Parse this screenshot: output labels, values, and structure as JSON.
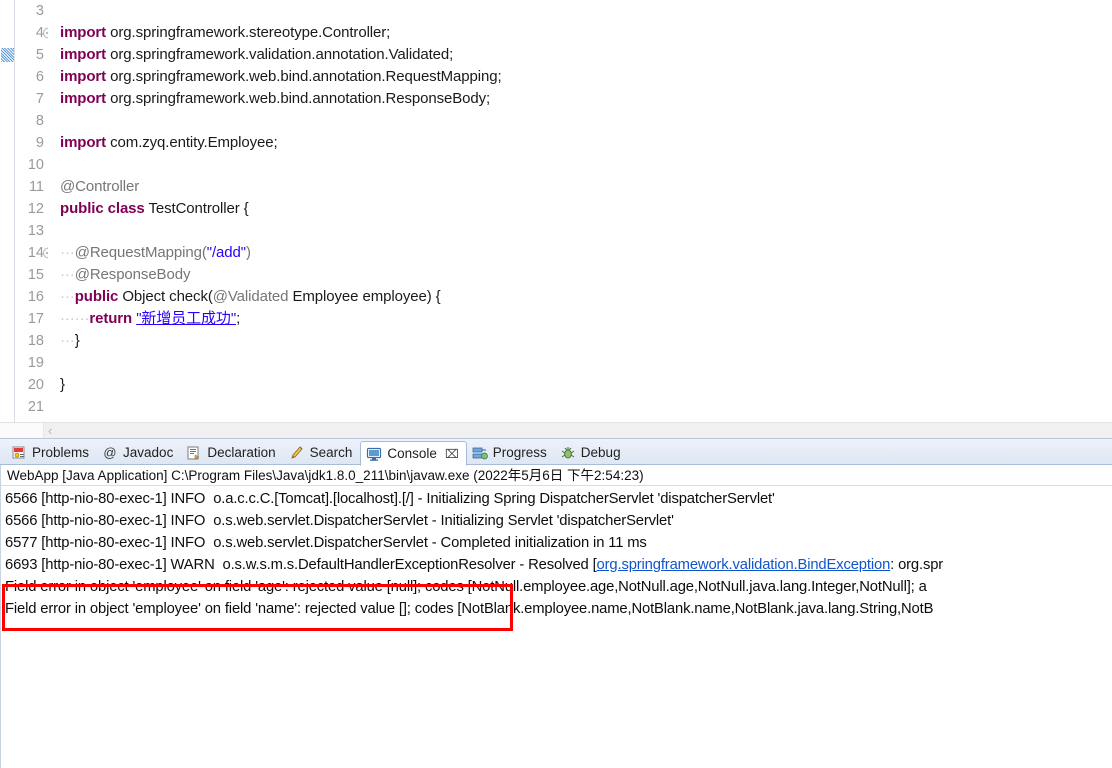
{
  "editor": {
    "lines": [
      {
        "num": "3",
        "fold": false,
        "segments": []
      },
      {
        "num": "4",
        "fold": true,
        "segments": [
          {
            "t": "import",
            "c": "kw"
          },
          {
            "t": " ",
            "c": "ws"
          },
          {
            "t": "org.springframework.stereotype.Controller;",
            "c": "plain"
          }
        ]
      },
      {
        "num": "5",
        "fold": false,
        "marker": true,
        "segments": [
          {
            "t": "import",
            "c": "kw"
          },
          {
            "t": " ",
            "c": "ws"
          },
          {
            "t": "org.springframework.validation.annotation.Validated;",
            "c": "plain"
          }
        ]
      },
      {
        "num": "6",
        "fold": false,
        "segments": [
          {
            "t": "import",
            "c": "kw"
          },
          {
            "t": " ",
            "c": "ws"
          },
          {
            "t": "org.springframework.web.bind.annotation.RequestMapping;",
            "c": "plain"
          }
        ]
      },
      {
        "num": "7",
        "fold": false,
        "segments": [
          {
            "t": "import",
            "c": "kw"
          },
          {
            "t": " ",
            "c": "ws"
          },
          {
            "t": "org.springframework.web.bind.annotation.ResponseBody;",
            "c": "plain"
          }
        ]
      },
      {
        "num": "8",
        "fold": false,
        "segments": []
      },
      {
        "num": "9",
        "fold": false,
        "segments": [
          {
            "t": "import",
            "c": "kw"
          },
          {
            "t": " ",
            "c": "ws"
          },
          {
            "t": "com.zyq.entity.Employee;",
            "c": "plain"
          }
        ]
      },
      {
        "num": "10",
        "fold": false,
        "segments": []
      },
      {
        "num": "11",
        "fold": false,
        "segments": [
          {
            "t": "@Controller",
            "c": "ann"
          }
        ]
      },
      {
        "num": "12",
        "fold": false,
        "segments": [
          {
            "t": "public class",
            "c": "kw"
          },
          {
            "t": " ",
            "c": "ws"
          },
          {
            "t": "TestController {",
            "c": "plain"
          }
        ]
      },
      {
        "num": "13",
        "fold": false,
        "segments": []
      },
      {
        "num": "14",
        "fold": true,
        "segments": [
          {
            "t": "···",
            "c": "ws"
          },
          {
            "t": "@RequestMapping(",
            "c": "ann"
          },
          {
            "t": "\"/add\"",
            "c": "str"
          },
          {
            "t": ")",
            "c": "ann"
          }
        ]
      },
      {
        "num": "15",
        "fold": false,
        "segments": [
          {
            "t": "···",
            "c": "ws"
          },
          {
            "t": "@ResponseBody",
            "c": "ann"
          }
        ]
      },
      {
        "num": "16",
        "fold": false,
        "segments": [
          {
            "t": "···",
            "c": "ws"
          },
          {
            "t": "public",
            "c": "kw"
          },
          {
            "t": " ",
            "c": "ws"
          },
          {
            "t": "Object check(",
            "c": "plain"
          },
          {
            "t": "@Validated",
            "c": "ann"
          },
          {
            "t": " ",
            "c": "ws"
          },
          {
            "t": "Employee employee) {",
            "c": "plain"
          }
        ]
      },
      {
        "num": "17",
        "fold": false,
        "segments": [
          {
            "t": "······",
            "c": "ws"
          },
          {
            "t": "return",
            "c": "kw"
          },
          {
            "t": " ",
            "c": "ws"
          },
          {
            "t": "\"新增员工成功\"",
            "c": "str-u"
          },
          {
            "t": ";",
            "c": "plain"
          }
        ]
      },
      {
        "num": "18",
        "fold": false,
        "segments": [
          {
            "t": "···",
            "c": "ws"
          },
          {
            "t": "}",
            "c": "plain"
          }
        ]
      },
      {
        "num": "19",
        "fold": false,
        "segments": []
      },
      {
        "num": "20",
        "fold": false,
        "segments": [
          {
            "t": "}",
            "c": "plain"
          }
        ]
      },
      {
        "num": "21",
        "fold": false,
        "segments": []
      }
    ],
    "scroll_left_chevron": "‹"
  },
  "tabs": [
    {
      "label": "Problems",
      "icon": "problems-icon",
      "active": false,
      "closable": false
    },
    {
      "label": "Javadoc",
      "icon": "javadoc-icon",
      "active": false,
      "closable": false
    },
    {
      "label": "Declaration",
      "icon": "declaration-icon",
      "active": false,
      "closable": false
    },
    {
      "label": "Search",
      "icon": "search-icon",
      "active": false,
      "closable": false
    },
    {
      "label": "Console",
      "icon": "console-icon",
      "active": true,
      "closable": true,
      "close_glyph": "⌧"
    },
    {
      "label": "Progress",
      "icon": "progress-icon",
      "active": false,
      "closable": false
    },
    {
      "label": "Debug",
      "icon": "debug-icon",
      "active": false,
      "closable": false
    }
  ],
  "console": {
    "header": "WebApp [Java Application] C:\\Program Files\\Java\\jdk1.8.0_211\\bin\\javaw.exe (2022年5月6日 下午2:54:23)",
    "lines": [
      {
        "parts": [
          {
            "t": "6566 [http-nio-80-exec-1] INFO  o.a.c.c.C.[Tomcat].[localhost].[/] - Initializing Spring DispatcherServlet 'dispatcherServlet'",
            "k": "text"
          }
        ]
      },
      {
        "parts": [
          {
            "t": "6566 [http-nio-80-exec-1] INFO  o.s.web.servlet.DispatcherServlet - Initializing Servlet 'dispatcherServlet'",
            "k": "text"
          }
        ]
      },
      {
        "parts": [
          {
            "t": "6577 [http-nio-80-exec-1] INFO  o.s.web.servlet.DispatcherServlet - Completed initialization in 11 ms",
            "k": "text"
          }
        ]
      },
      {
        "parts": [
          {
            "t": "6693 [http-nio-80-exec-1] WARN  o.s.w.s.m.s.DefaultHandlerExceptionResolver - Resolved [",
            "k": "text"
          },
          {
            "t": "org.springframework.validation.BindException",
            "k": "link"
          },
          {
            "t": ": org.spr",
            "k": "text"
          }
        ]
      },
      {
        "parts": [
          {
            "t": "Field error in object 'employee' on field 'age': rejected value [null]; codes [NotNull.employee.age,NotNull.age,NotNull.java.lang.Integer,NotNull]; a",
            "k": "text"
          }
        ]
      },
      {
        "parts": [
          {
            "t": "Field error in object 'employee' on field 'name': rejected value []; codes [NotBlank.employee.name,NotBlank.name,NotBlank.java.lang.String,NotB",
            "k": "text"
          }
        ]
      }
    ],
    "highlight_box_color": "#ff0000"
  }
}
